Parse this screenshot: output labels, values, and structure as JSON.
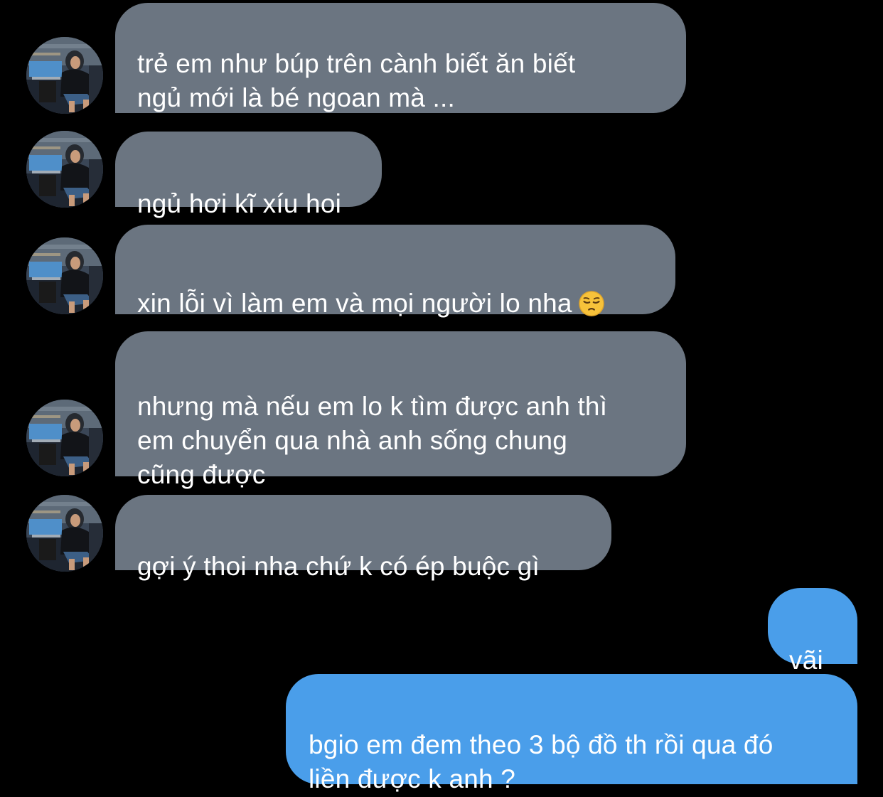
{
  "conversation": {
    "messages": [
      {
        "id": "m1",
        "sender": "contact",
        "text": "trẻ em như búp trên cành biết ăn biết\nngủ mới là bé ngoan mà ..."
      },
      {
        "id": "m2",
        "sender": "contact",
        "text": "ngủ hơi kĩ xíu hoi"
      },
      {
        "id": "m3",
        "sender": "contact",
        "text": "xin lỗi vì làm em và mọi người lo nha",
        "emoji": "pensive-face"
      },
      {
        "id": "m4",
        "sender": "contact",
        "text": "nhưng mà nếu em lo k tìm được anh thì\nem chuyển qua nhà anh sống chung\ncũng được"
      },
      {
        "id": "m5",
        "sender": "contact",
        "text": "gợi ý thoi nha chứ k có ép buộc gì"
      },
      {
        "id": "m6",
        "sender": "me",
        "text": "vãi"
      },
      {
        "id": "m7",
        "sender": "me",
        "text": "bgio em đem theo 3 bộ đồ th rồi qua đó\nliền được k anh ?"
      }
    ]
  },
  "theme": {
    "background": "#000000",
    "incoming_bubble": "#6b7581",
    "outgoing_bubble": "#4a9eea",
    "text_color": "#ffffff"
  },
  "icons": {
    "avatar": "contact-avatar-photo",
    "emoji": "pensive-face"
  }
}
